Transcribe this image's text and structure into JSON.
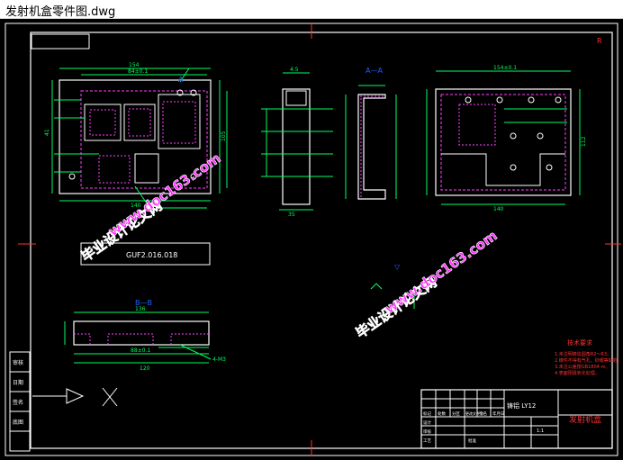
{
  "window": {
    "title": "发射机盒零件图.dwg"
  },
  "drawing": {
    "part_code": "GUF2.016.018",
    "section_aa": "A—A",
    "section_bb": "B—B",
    "material": "铸铝 LY12",
    "part_name": "发射机盒",
    "watermark_text": "毕业设计论文网",
    "watermark_url": "www.doc163.com",
    "tech_req_title": "技术要求",
    "tech_req_lines": [
      "1.未注明铸造圆角R2～R3。",
      "2.铸件不得有气孔、砂眼等缺陷。",
      "3.未注公差按GB1804-m。",
      "4.表面阳极氧化处理。"
    ],
    "title_block": {
      "headers": [
        "标记",
        "处数",
        "分区",
        "更改文件号",
        "签名",
        "年月日"
      ],
      "scale": "1:1",
      "labels": [
        "设计",
        "审核",
        "工艺",
        "批准"
      ]
    },
    "dims": {
      "front_top": "154",
      "front_inner": "84±0.1",
      "front_side": "41",
      "front_height": "105",
      "front_bottom": "140",
      "side_top": "4.5",
      "side_bottom": "35",
      "right_top": "154±0.1",
      "right_bottom": "140",
      "right_side": "112",
      "bb_top": "136",
      "bb_mid": "88±0.1",
      "bb_bottom": "120",
      "bb_right": "4-M3"
    },
    "left_strip_labels": [
      "审核",
      "日期",
      "签名",
      "底图"
    ]
  }
}
